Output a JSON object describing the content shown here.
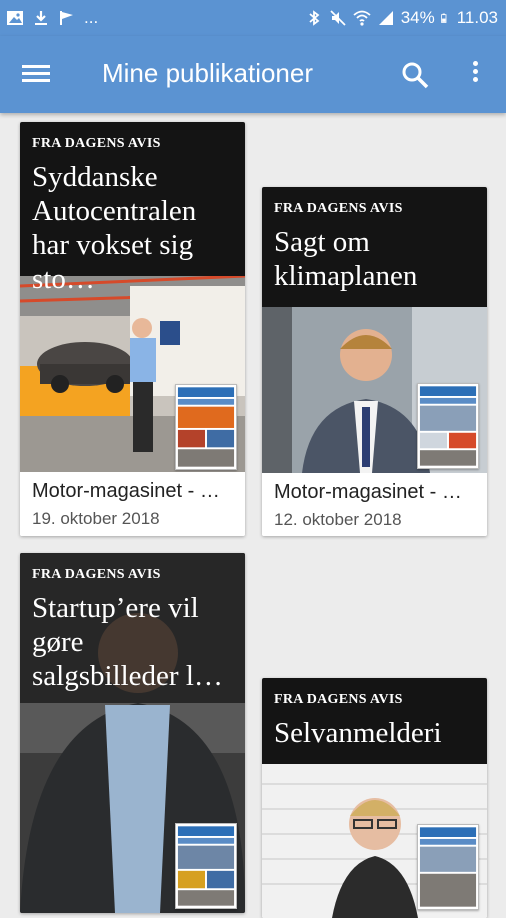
{
  "status_bar": {
    "left_icons": [
      "image-icon",
      "download-icon",
      "flag-icon"
    ],
    "more": "...",
    "battery": "34%",
    "time": "11.03"
  },
  "app_bar": {
    "title": "Mine publikationer",
    "menu_icon": "hamburger-menu-icon",
    "search_icon": "search-icon",
    "overflow_icon": "more-vert-icon"
  },
  "cards": [
    {
      "kicker": "FRA DAGENS AVIS",
      "headline": "Syddanske Autocentralen har vokset sig sto…",
      "source": "Motor-magasinet - …",
      "date": "19. oktober 2018",
      "image": "car-dealership-photo"
    },
    {
      "kicker": "FRA DAGENS AVIS",
      "headline": "Sagt om klimaplanen",
      "source": "Motor-magasinet - …",
      "date": "12. oktober 2018",
      "image": "man-in-suit-portrait"
    },
    {
      "kicker": "FRA DAGENS AVIS",
      "headline": "Startup’ere vil gøre salgsbilleder l…",
      "source": "",
      "date": "",
      "image": "smiling-man-portrait"
    },
    {
      "kicker": "FRA DAGENS AVIS",
      "headline": "Selvanmelderi",
      "source": "",
      "date": "",
      "image": "woman-glasses-portrait"
    }
  ]
}
